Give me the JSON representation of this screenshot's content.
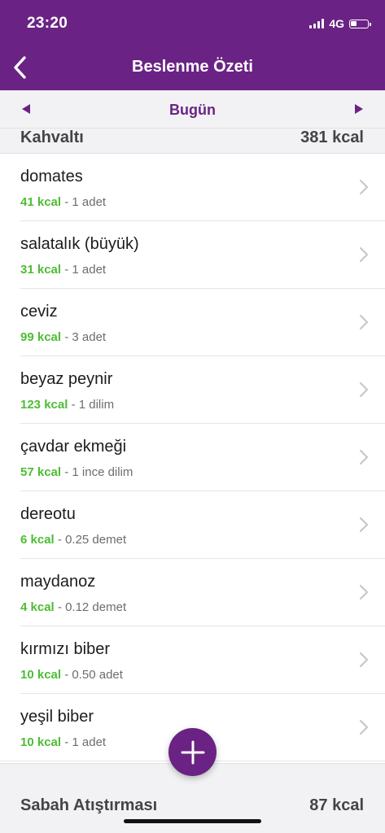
{
  "status_bar": {
    "time": "23:20",
    "network": "4G"
  },
  "header": {
    "title": "Beslenme Özeti",
    "back_icon": "chevron-left-icon"
  },
  "date_nav": {
    "label": "Bugün",
    "prev_icon": "triangle-left-icon",
    "next_icon": "triangle-right-icon"
  },
  "breakfast": {
    "name": "Kahvaltı",
    "kcal": "381 kcal"
  },
  "items": [
    {
      "name": "domates",
      "kcal": "41 kcal",
      "portion": "1 adet"
    },
    {
      "name": "salatalık (büyük)",
      "kcal": "31 kcal",
      "portion": "1 adet"
    },
    {
      "name": "ceviz",
      "kcal": "99 kcal",
      "portion": "3 adet"
    },
    {
      "name": "beyaz peynir",
      "kcal": "123 kcal",
      "portion": "1 dilim"
    },
    {
      "name": "çavdar ekmeği",
      "kcal": "57 kcal",
      "portion": "1 ince dilim"
    },
    {
      "name": "dereotu",
      "kcal": "6 kcal",
      "portion": "0.25 demet"
    },
    {
      "name": "maydanoz",
      "kcal": "4 kcal",
      "portion": "0.12 demet"
    },
    {
      "name": "kırmızı biber",
      "kcal": "10 kcal",
      "portion": "0.50 adet"
    },
    {
      "name": "yeşil biber",
      "kcal": "10 kcal",
      "portion": "1 adet"
    }
  ],
  "separator": "-",
  "snack": {
    "name": "Sabah Atıştırması",
    "kcal": "87 kcal"
  },
  "fab": {
    "icon": "plus-icon"
  },
  "colors": {
    "brand_purple": "#6a2384",
    "kcal_green": "#4dbd34",
    "section_background": "#f2f2f4"
  }
}
